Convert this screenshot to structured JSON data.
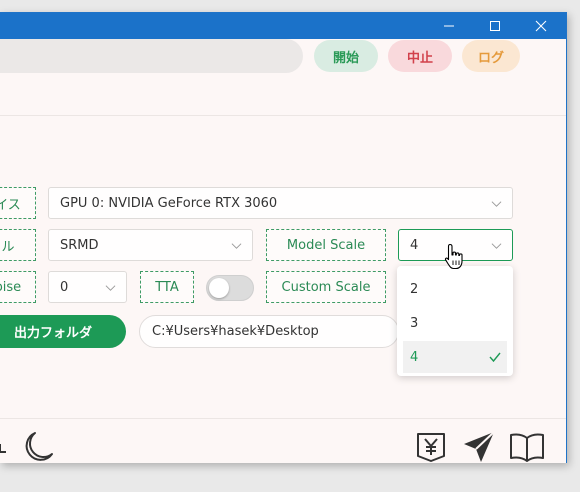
{
  "titlebar": {
    "bg_color": "#1b72c9",
    "minimize_icon": "minimize-icon",
    "maximize_icon": "maximize-icon",
    "close_icon": "close-icon"
  },
  "toolbar": {
    "start_label": "開始",
    "stop_label": "中止",
    "log_label": "ログ"
  },
  "settings": {
    "device_label_partial": "イス",
    "device_value": "GPU 0: NVIDIA GeForce RTX 3060",
    "model_label_partial": "ル",
    "model_value": "SRMD",
    "model_scale_label": "Model Scale",
    "model_scale_value": "4",
    "denoise_label_partial": "oise",
    "denoise_value": "0",
    "tta_label": "TTA",
    "tta_enabled": false,
    "custom_scale_label": "Custom Scale",
    "output_folder_label": "出力フォルダ",
    "output_folder_value": "C:¥Users¥hasek¥Desktop"
  },
  "scale_dropdown": {
    "options": [
      "2",
      "3",
      "4"
    ],
    "selected": "4"
  },
  "footer": {
    "icons": [
      "moon-icon",
      "donate-icon",
      "send-icon",
      "book-icon"
    ]
  },
  "colors": {
    "accent_green": "#1d9a56",
    "start_bg": "#d9ece2",
    "stop_bg": "#f9d9dc",
    "log_bg": "#fbe7d2"
  }
}
